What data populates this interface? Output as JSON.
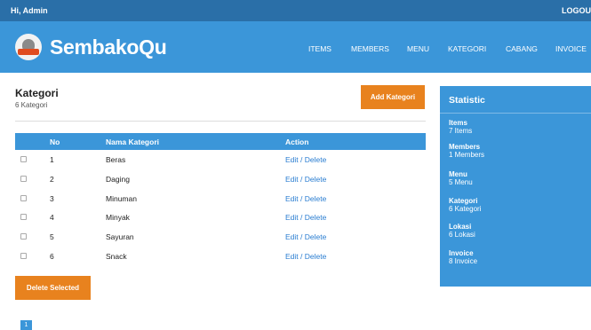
{
  "topbar": {
    "greeting": "Hi, Admin",
    "logout": "LOGOUT"
  },
  "brand": {
    "name": "SembakoQu"
  },
  "nav": [
    "ITEMS",
    "MEMBERS",
    "MENU",
    "KATEGORI",
    "CABANG",
    "INVOICE"
  ],
  "page": {
    "title": "Kategori",
    "count": "6 Kategori",
    "add_button": "Add Kategori",
    "delete_button": "Delete Selected",
    "current_page": "1"
  },
  "table": {
    "headers": {
      "no": "No",
      "name": "Nama Kategori",
      "action": "Action"
    },
    "action_label": "Edit / Delete",
    "rows": [
      {
        "no": "1",
        "name": "Beras"
      },
      {
        "no": "2",
        "name": "Daging"
      },
      {
        "no": "3",
        "name": "Minuman"
      },
      {
        "no": "4",
        "name": "Minyak"
      },
      {
        "no": "5",
        "name": "Sayuran"
      },
      {
        "no": "6",
        "name": "Snack"
      }
    ]
  },
  "statistic": {
    "title": "Statistic",
    "items": [
      {
        "label": "Items",
        "value": "7 Items"
      },
      {
        "label": "Members",
        "value": "1 Members"
      },
      {
        "label": "Menu",
        "value": "5 Menu"
      },
      {
        "label": "Kategori",
        "value": "6 Kategori"
      },
      {
        "label": "Lokasi",
        "value": "6 Lokasi"
      },
      {
        "label": "Invoice",
        "value": "8 Invoice"
      }
    ]
  },
  "colors": {
    "primary": "#3b96d9",
    "topbar": "#2a6fa8",
    "accent": "#e8821e",
    "link": "#2a7dd1"
  },
  "icons": {
    "logo": "grocery-sack-logo-icon"
  }
}
